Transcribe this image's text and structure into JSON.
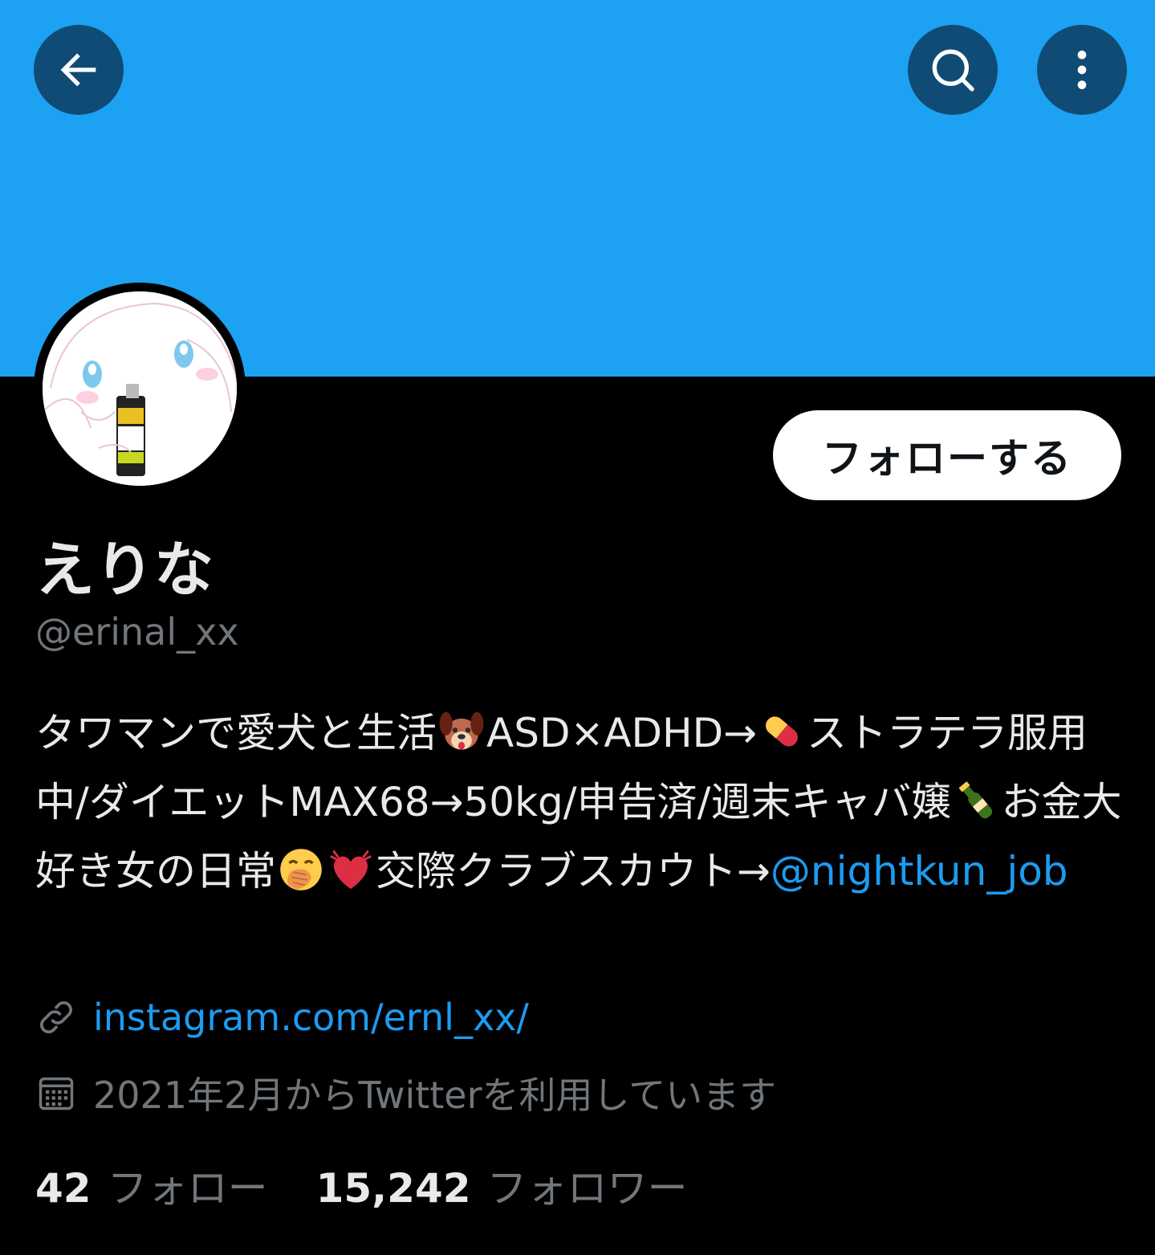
{
  "colors": {
    "banner": "#1da1f2",
    "background": "#000000",
    "text_primary": "#e7e9ea",
    "text_secondary": "#71767b",
    "link": "#1d9bf0",
    "header_button": "#0f4b75"
  },
  "header": {
    "back_icon": "arrow-left-icon",
    "search_icon": "search-icon",
    "more_icon": "more-vertical-icon"
  },
  "profile": {
    "avatar_icon": "cinnamoroll-avatar",
    "follow_label": "フォローする",
    "display_name": "えりな",
    "handle": "@erinal_xx",
    "bio": {
      "part1": "タワマンで愛犬と生活",
      "emoji_dog": "dog-face-emoji",
      "part2": "ASD×ADHD→",
      "emoji_pill": "pill-emoji",
      "part3": "ストラテラ服用中/ダイエットMAX68→50kg/申告済/週末キャバ嬢",
      "emoji_bottle": "champagne-emoji",
      "part4": "お金大好き女の日常",
      "emoji_face": "hand-over-mouth-emoji",
      "emoji_heart": "beating-heart-emoji",
      "part5": "交際クラブスカウト→",
      "mention": "@nightkun_job"
    },
    "link": "instagram.com/ernl_xx/",
    "link_icon": "link-icon",
    "joined": "2021年2月からTwitterを利用しています",
    "joined_icon": "calendar-icon"
  },
  "stats": {
    "following_count": "42",
    "following_label": "フォロー",
    "followers_count": "15,242",
    "followers_label": "フォロワー"
  }
}
